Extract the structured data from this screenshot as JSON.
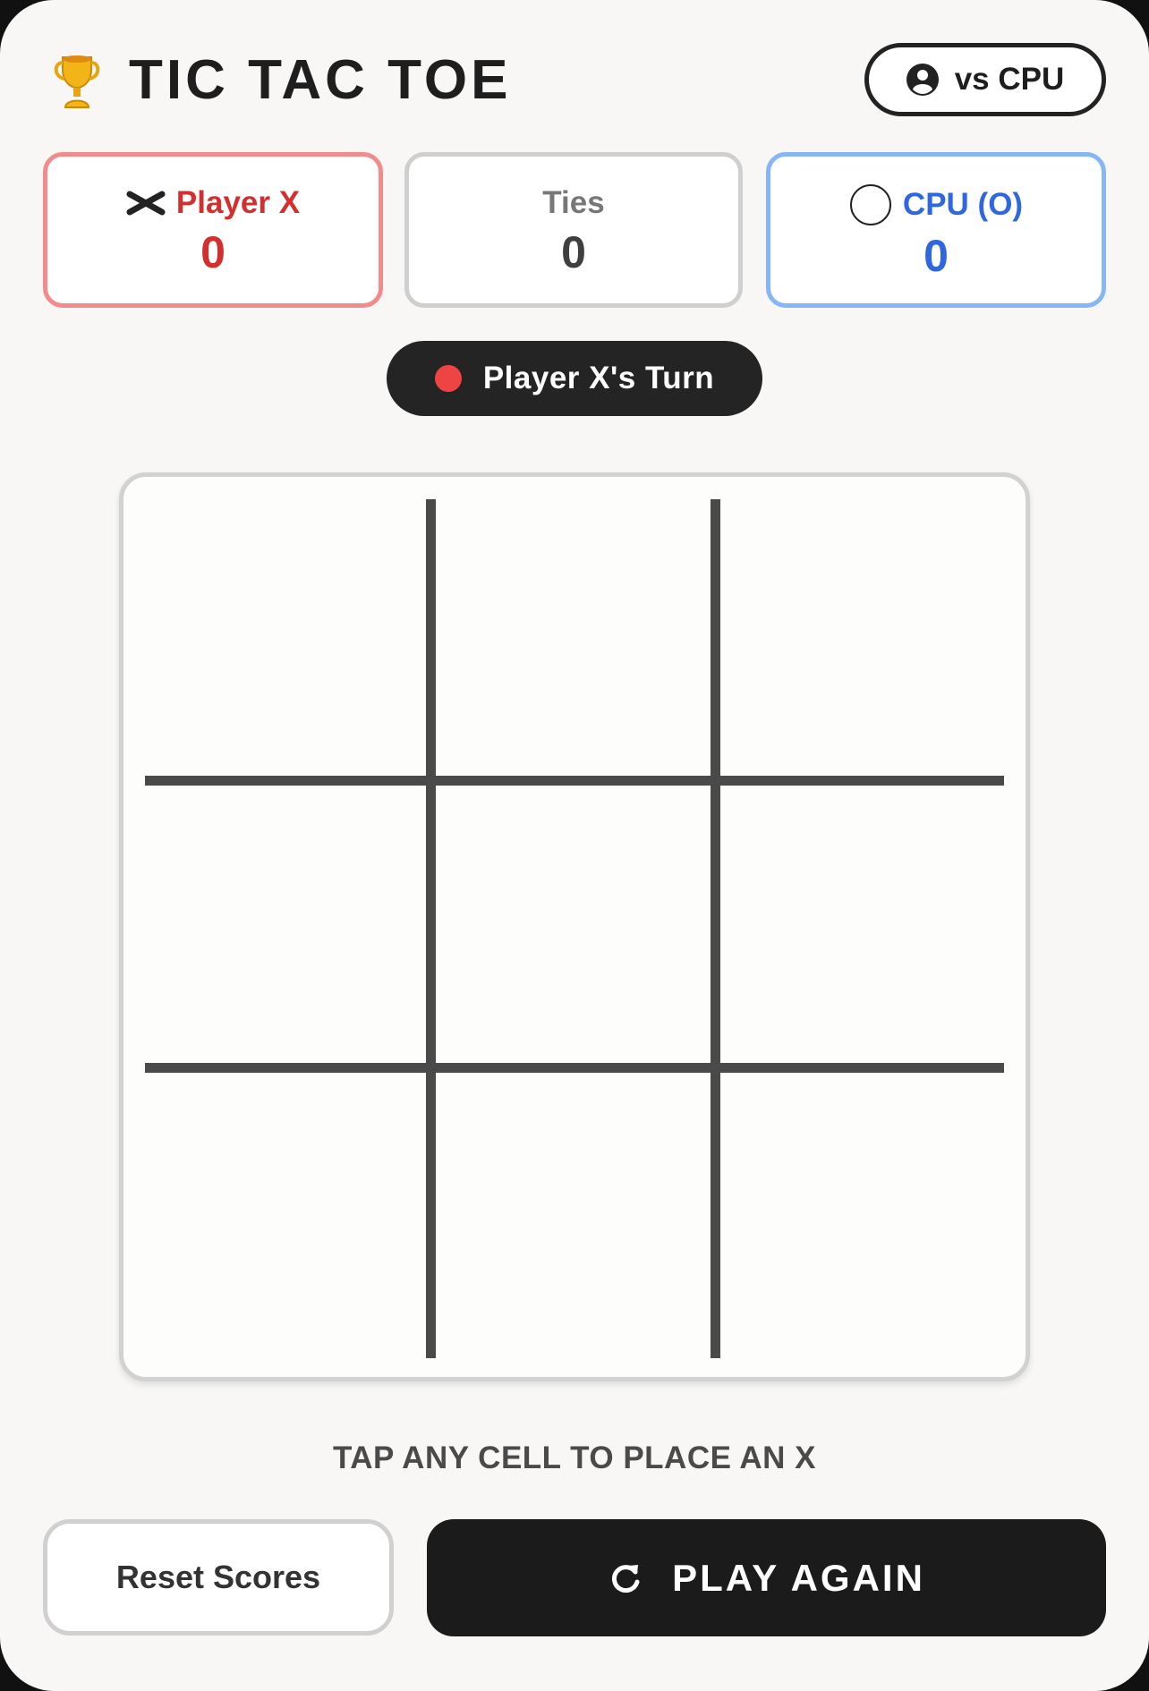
{
  "header": {
    "title": "TIC TAC TOE",
    "icon": "trophy-icon",
    "mode_button": {
      "label": "vs CPU",
      "icon": "user-circle-icon"
    }
  },
  "scores": {
    "player_x": {
      "label": "Player X",
      "score": "0",
      "icon": "x-icon",
      "color": "#d42f2f"
    },
    "ties": {
      "label": "Ties",
      "score": "0"
    },
    "cpu_o": {
      "label": "CPU (O)",
      "score": "0",
      "icon": "o-icon",
      "color": "#2f67de"
    }
  },
  "turn": {
    "label": "Player X's Turn",
    "dot_color": "#ef4444"
  },
  "board": {
    "cells": [
      "",
      "",
      "",
      "",
      "",
      "",
      "",
      "",
      ""
    ]
  },
  "hint": "TAP ANY CELL TO PLACE AN X",
  "actions": {
    "reset_label": "Reset Scores",
    "play_again_label": "PLAY AGAIN",
    "play_again_icon": "refresh-icon"
  }
}
